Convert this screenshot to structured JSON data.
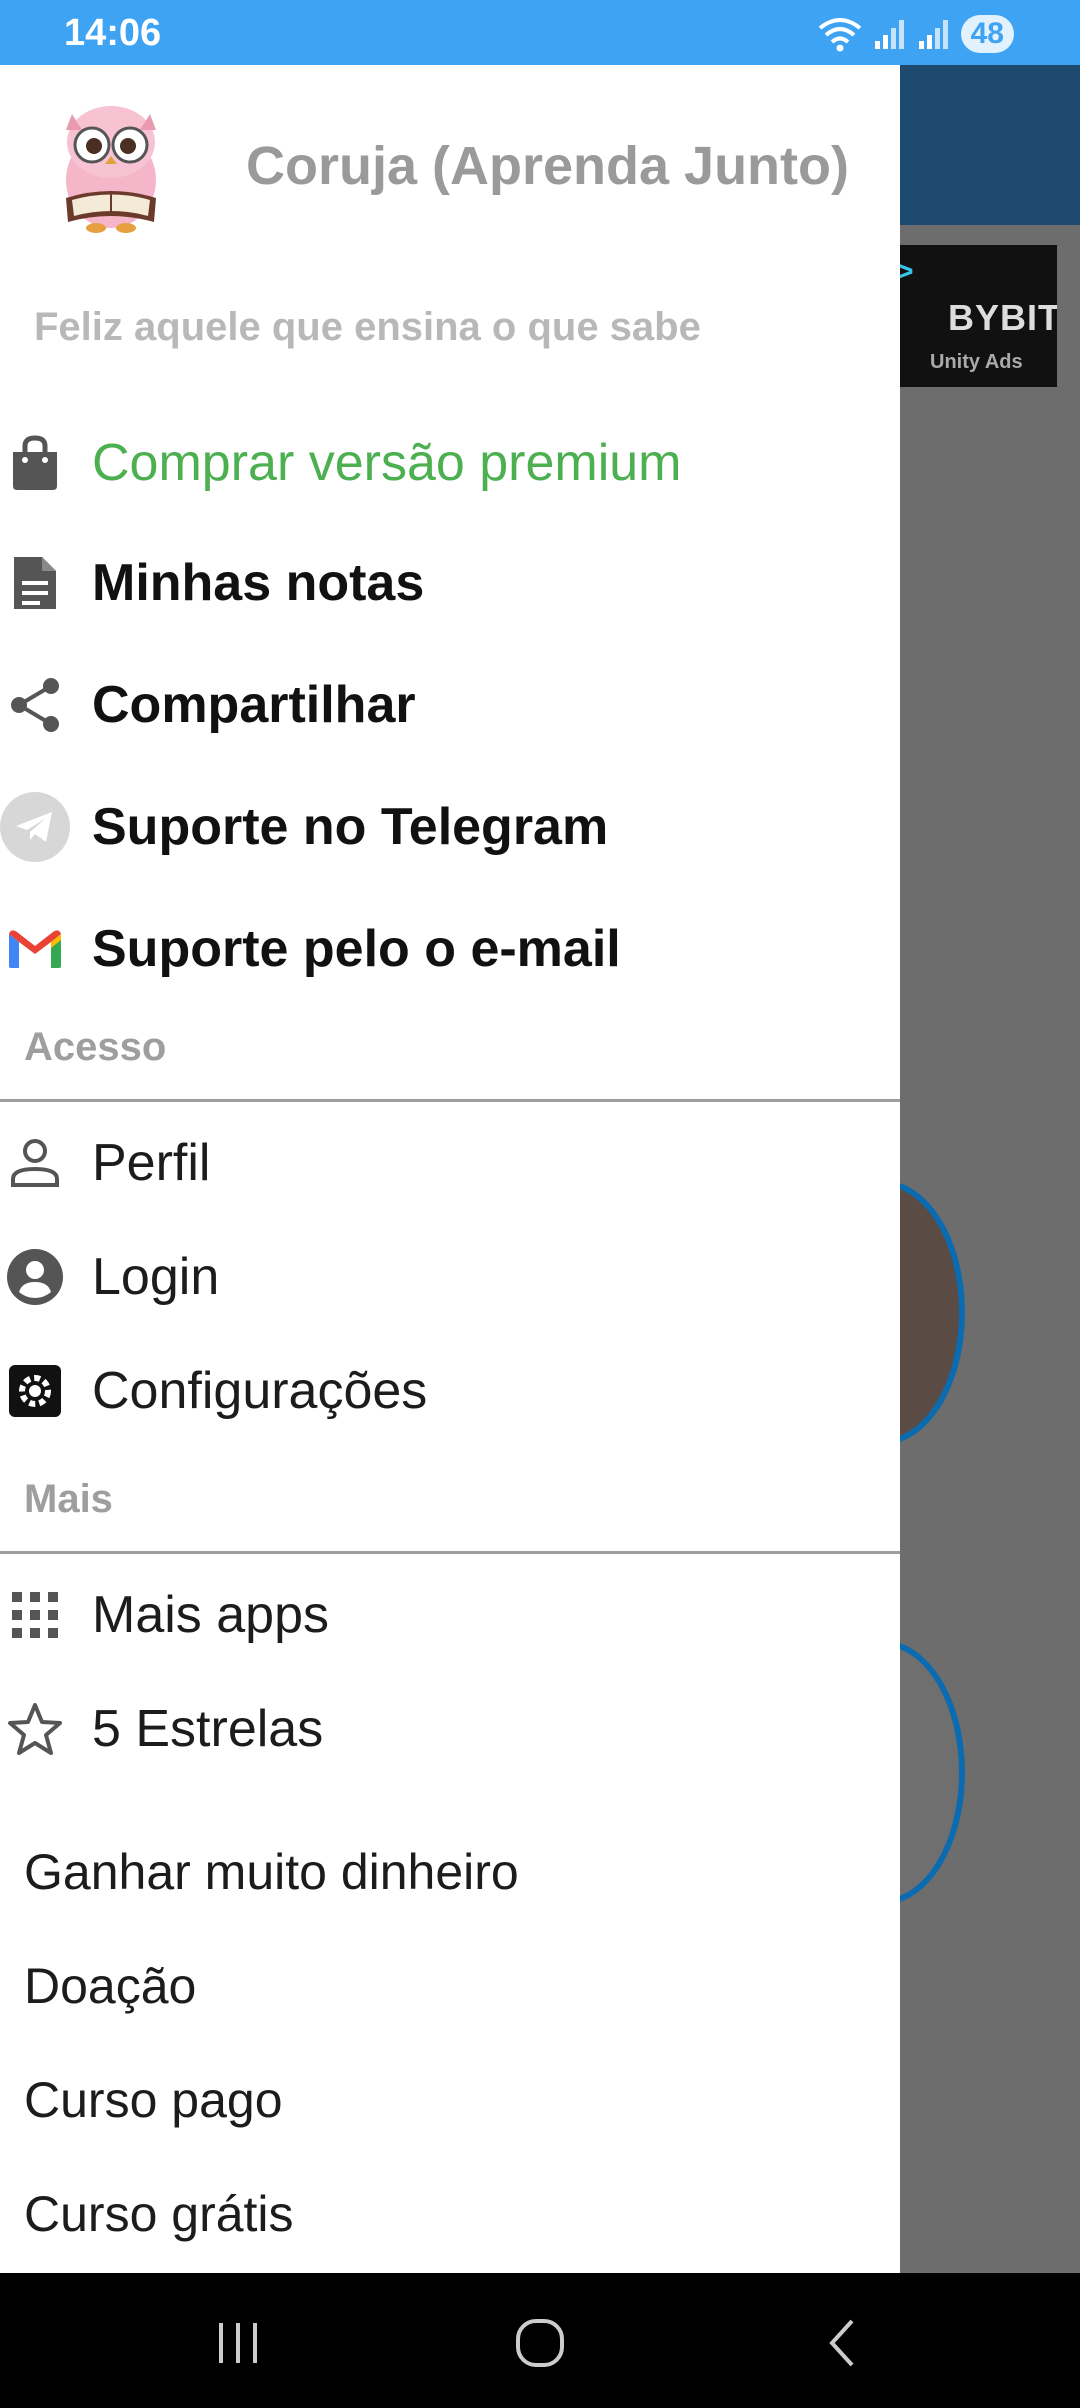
{
  "status_bar": {
    "time": "14:06",
    "battery": "48"
  },
  "background_app": {
    "ad_brand": "BYBIT",
    "ad_network": "Unity Ads"
  },
  "drawer": {
    "app_title": "Coruja (Aprenda Junto)",
    "tagline": "Feliz aquele que ensina o que sabe",
    "main_items": [
      {
        "label": "Comprar versão premium",
        "icon": "shopping-bag-icon"
      },
      {
        "label": "Minhas notas",
        "icon": "document-icon"
      },
      {
        "label": "Compartilhar",
        "icon": "share-icon"
      },
      {
        "label": "Suporte no Telegram",
        "icon": "telegram-icon"
      },
      {
        "label": "Suporte pelo o e-mail",
        "icon": "gmail-icon"
      }
    ],
    "section_access": "Acesso",
    "access_items": [
      {
        "label": "Perfil",
        "icon": "person-outline-icon"
      },
      {
        "label": "Login",
        "icon": "account-circle-icon"
      },
      {
        "label": "Configurações",
        "icon": "gear-icon"
      }
    ],
    "section_more": "Mais",
    "more_items": [
      {
        "label": "Mais apps",
        "icon": "apps-grid-icon"
      },
      {
        "label": "5 Estrelas",
        "icon": "star-outline-icon"
      }
    ],
    "extra_items": [
      {
        "label": "Ganhar muito dinheiro"
      },
      {
        "label": "Doação"
      },
      {
        "label": "Curso pago"
      },
      {
        "label": "Curso grátis"
      }
    ]
  },
  "colors": {
    "status_bar": "#3fa3f3",
    "premium_green": "#4caf50",
    "section_gray": "#9e9e9e"
  }
}
